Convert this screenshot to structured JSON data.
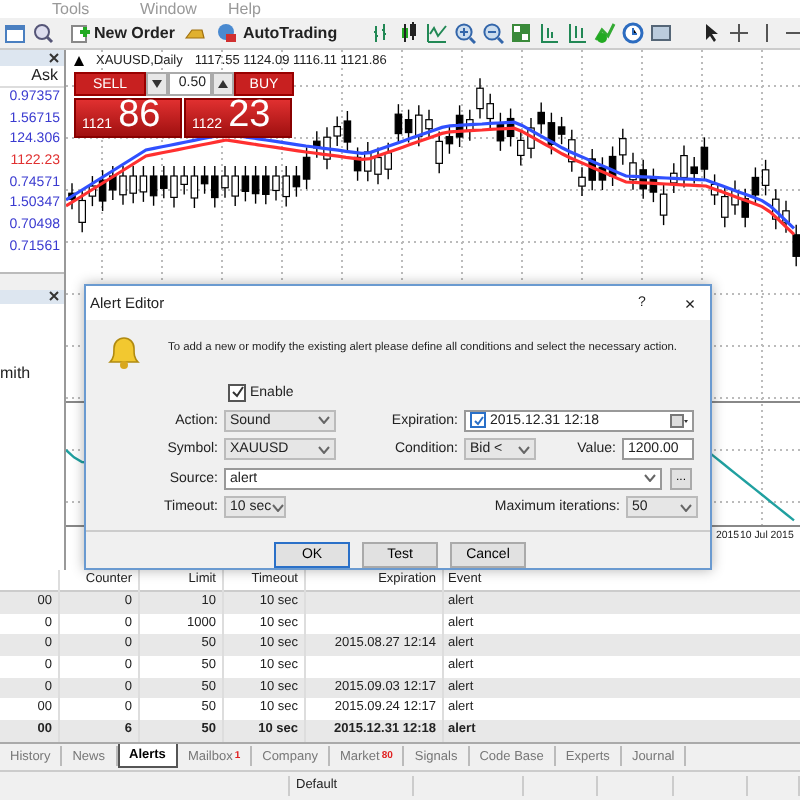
{
  "menu": [
    "Tools",
    "Window",
    "Help"
  ],
  "toolbar": {
    "new_order": "New Order",
    "autotrading": "AutoTrading"
  },
  "market_watch": {
    "header": "Ask",
    "rows": [
      {
        "ask": "0.97357",
        "color": "#3a3ad0"
      },
      {
        "ask": "1.56715",
        "color": "#3a3ad0"
      },
      {
        "ask": "124.306",
        "color": "#3a3ad0"
      },
      {
        "ask": "1122.23",
        "color": "#e03030"
      },
      {
        "ask": "0.74571",
        "color": "#3a3ad0"
      },
      {
        "ask": "1.50347",
        "color": "#3a3ad0"
      },
      {
        "ask": "0.70498",
        "color": "#3a3ad0"
      },
      {
        "ask": "0.71561",
        "color": "#3a3ad0"
      }
    ]
  },
  "navigator": {
    "item": "mith"
  },
  "chart": {
    "title": "XAUUSD,Daily",
    "ohlc": "1117.55 1124.09 1116.11 1121.86",
    "sell": "SELL",
    "buy": "BUY",
    "lot": "0.50",
    "bid_big": "1121",
    "bid_small": "86",
    "ask_big": "1122",
    "ask_small": "23",
    "dates": [
      "2015",
      "10 Jul 2015"
    ]
  },
  "dialog": {
    "title": "Alert Editor",
    "help": "?",
    "close": "×",
    "message": "To add a new or modify the existing alert please define all conditions and select the necessary action.",
    "enable": {
      "label": "Enable",
      "checked": true
    },
    "action": {
      "label": "Action:",
      "value": "Sound"
    },
    "symbol": {
      "label": "Symbol:",
      "value": "XAUUSD"
    },
    "source": {
      "label": "Source:",
      "value": "alert"
    },
    "timeout": {
      "label": "Timeout:",
      "value": "10 sec"
    },
    "expiration": {
      "label": "Expiration:",
      "value": "2015.12.31 12:18",
      "checked": true
    },
    "condition": {
      "label": "Condition:",
      "value": "Bid <"
    },
    "value_field": {
      "label": "Value:",
      "value": "1200.00"
    },
    "max_iterations": {
      "label": "Maximum iterations:",
      "value": "50"
    },
    "browse": "...",
    "buttons": [
      "OK",
      "Test",
      "Cancel"
    ]
  },
  "table": {
    "columns": [
      "Counter",
      "Limit",
      "Timeout",
      "Expiration",
      "Event"
    ],
    "rows": [
      {
        "column_1": "00",
        "counter": "0",
        "limit": "10",
        "timeout": "10 sec",
        "event": "alert",
        "active": false
      },
      {
        "column_1": "0",
        "counter": "0",
        "limit": "1000",
        "timeout": "10 sec",
        "event": "alert",
        "active": false
      },
      {
        "column_1": "0",
        "counter": "0",
        "limit": "50",
        "timeout": "10 sec",
        "expiration": "2015.08.27 12:14",
        "event": "alert",
        "active": false
      },
      {
        "column_1": "0",
        "counter": "0",
        "limit": "50",
        "timeout": "10 sec",
        "event": "alert",
        "active": false
      },
      {
        "column_1": "0",
        "counter": "0",
        "limit": "50",
        "timeout": "10 sec",
        "expiration": "2015.09.03 12:17",
        "event": "alert",
        "active": false
      },
      {
        "column_1": "00",
        "counter": "0",
        "limit": "50",
        "timeout": "10 sec",
        "expiration": "2015.09.24 12:17",
        "event": "alert",
        "active": false
      },
      {
        "column_1": "00",
        "counter": "6",
        "limit": "50",
        "timeout": "10 sec",
        "expiration": "2015.12.31 12:18",
        "event": "alert",
        "active": true
      }
    ]
  },
  "tabs": [
    {
      "label": "History",
      "selected": false
    },
    {
      "label": "News",
      "selected": false
    },
    {
      "label": "Alerts",
      "selected": true
    },
    {
      "label": "Mailbox",
      "selected": false,
      "badge": "1"
    },
    {
      "label": "Company",
      "selected": false
    },
    {
      "label": "Market",
      "selected": false,
      "badge": "80"
    },
    {
      "label": "Signals",
      "selected": false
    },
    {
      "label": "Code Base",
      "selected": false
    },
    {
      "label": "Experts",
      "selected": false
    },
    {
      "label": "Journal",
      "selected": false
    }
  ],
  "status_bar": {
    "profile": "Default"
  }
}
